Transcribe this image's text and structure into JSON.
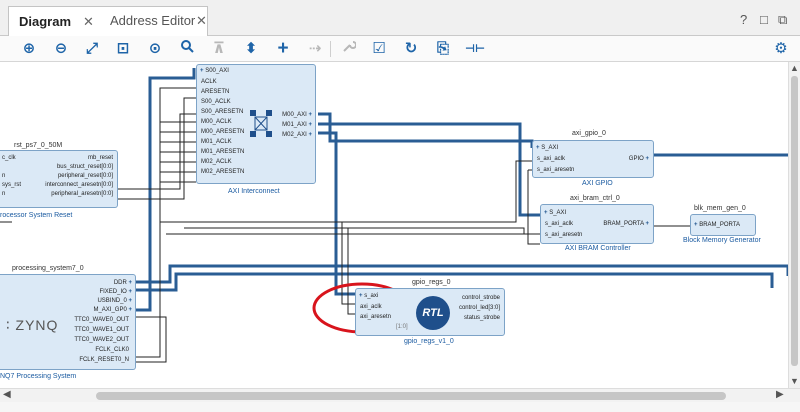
{
  "tabs": [
    {
      "label": "Diagram",
      "active": true
    },
    {
      "label": "Address Editor",
      "active": false
    }
  ],
  "window_buttons": {
    "help": "?",
    "restore": "□",
    "maximize": "⧉"
  },
  "toolbar": {
    "zoom_in": "⊕",
    "zoom_out": "⊖",
    "fit": "⤢",
    "fit_selection": "⊡",
    "auto_connect": "⊙",
    "search": "🔍",
    "collapse": "⊼",
    "expand": "⬍",
    "add_ip": "+",
    "validate_disabled": "⇢",
    "wrench": "🔧",
    "check": "☑",
    "refresh": "↻",
    "regenerate": "⎘",
    "port": "⊣⊢",
    "settings": "⚙"
  },
  "blocks": {
    "axi_interconnect": {
      "caption": "AXI Interconnect",
      "left_pins": [
        "S00_AXI",
        "ACLK",
        "ARESETN",
        "S00_ACLK",
        "S00_ARESETN",
        "M00_ACLK",
        "M00_ARESETN",
        "M01_ACLK",
        "M01_ARESETN",
        "M02_ACLK",
        "M02_ARESETN"
      ],
      "right_pins": [
        "M00_AXI",
        "M01_AXI",
        "M02_AXI"
      ]
    },
    "rst": {
      "title": "rst_ps7_0_50M",
      "caption": "rocessor System Reset",
      "left_pins": [
        "c_clk",
        "",
        "n",
        "sys_rst",
        "n"
      ],
      "right_pins": [
        "mb_reset",
        "bus_struct_reset[0:0]",
        "peripheral_reset[0:0]",
        "interconnect_aresetn[0:0]",
        "peripheral_aresetn[0:0]"
      ]
    },
    "axi_gpio": {
      "title": "axi_gpio_0",
      "caption": "AXI GPIO",
      "left_pins": [
        "S_AXI",
        "s_axi_aclk",
        "s_axi_aresetn"
      ],
      "right_pins": [
        "GPIO"
      ]
    },
    "bram_ctrl": {
      "title": "axi_bram_ctrl_0",
      "caption": "AXI BRAM Controller",
      "left_pins": [
        "S_AXI",
        "s_axi_aclk",
        "s_axi_aresetn"
      ],
      "right_pins": [
        "BRAM_PORTA"
      ]
    },
    "blk_mem": {
      "title": "blk_mem_gen_0",
      "caption": "Block Memory Generator",
      "pin": "BRAM_PORTA"
    },
    "ps7": {
      "title": "processing_system7_0",
      "caption": "NQ7 Processing System",
      "logo": "ZYNQ",
      "right_pins": [
        "DDR",
        "FIXED_IO",
        "USBIND_0",
        "M_AXI_GP0",
        "TTC0_WAVE0_OUT",
        "TTC0_WAVE1_OUT",
        "TTC0_WAVE2_OUT",
        "FCLK_CLK0",
        "FCLK_RESET0_N"
      ]
    },
    "gpio_regs": {
      "title": "gpio_regs_0",
      "caption": "gpio_regs_v1_0",
      "logo": "RTL",
      "left_pins": [
        "s_axi",
        "axi_aclk",
        "axi_aresetn",
        "[1:0]"
      ],
      "right_pins": [
        "control_strobe",
        "control_led[3:0]",
        "status_strobe"
      ]
    }
  },
  "colors": {
    "block_fill": "#dbe9f6",
    "block_border": "#7da3c7",
    "bus_wire": "#2a5d94",
    "signal_wire": "#222222",
    "highlight_circle": "#d8141c",
    "toolbar_icon": "#1e64a8"
  }
}
